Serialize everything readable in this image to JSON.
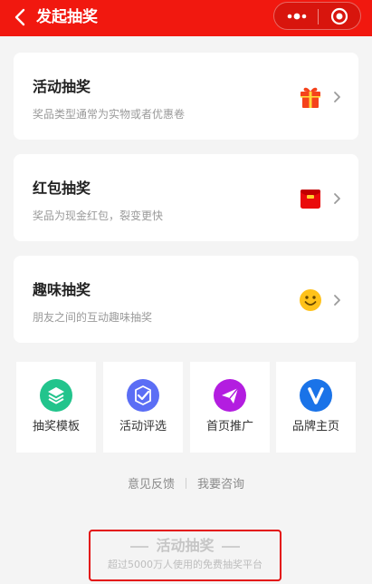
{
  "header": {
    "title": "发起抽奖",
    "back_icon": "chevron-left-icon",
    "more_icon": "more-dots-icon",
    "close_icon": "target-close-icon",
    "color": "#f1180f"
  },
  "cards": [
    {
      "title": "活动抽奖",
      "desc": "奖品类型通常为实物或者优惠卷",
      "icon": "gift-icon"
    },
    {
      "title": "红包抽奖",
      "desc": "奖品为现金红包，裂变更快",
      "icon": "red-envelope-icon"
    },
    {
      "title": "趣味抽奖",
      "desc": "朋友之间的互动趣味抽奖",
      "icon": "smiley-icon"
    }
  ],
  "grid": [
    {
      "label": "抽奖模板",
      "icon": "layers-icon",
      "color": "#22c48c"
    },
    {
      "label": "活动评选",
      "icon": "check-badge-icon",
      "color": "#5b6ef5"
    },
    {
      "label": "首页推广",
      "icon": "paper-plane-icon",
      "color": "#b31de0"
    },
    {
      "label": "品牌主页",
      "icon": "v-badge-icon",
      "color": "#1a73e8"
    }
  ],
  "links": {
    "feedback": "意见反馈",
    "consult": "我要咨询"
  },
  "brand": {
    "title": "活动抽奖",
    "subtitle": "超过5000万人使用的免费抽奖平台"
  }
}
